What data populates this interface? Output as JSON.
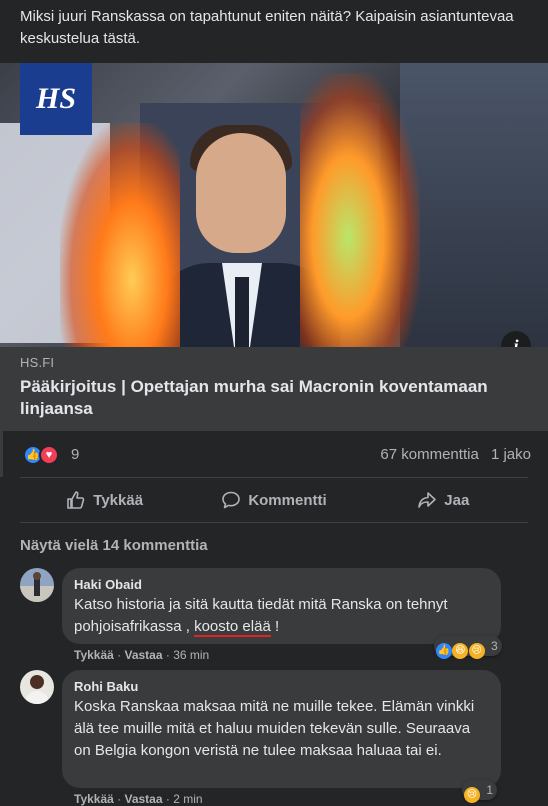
{
  "post": {
    "text": "Miksi juuri Ranskassa on tapahtunut eniten näitä? Kaipaisin asiantuntevaa keskustelua tästä."
  },
  "link": {
    "logo_text": "HS",
    "source": "HS.FI",
    "headline": "Pääkirjoitus | Opettajan murha sai Macronin koventamaan linjaansa",
    "info_icon": "i"
  },
  "stats": {
    "reaction_count": "9",
    "comments": "67 kommenttia",
    "shares": "1 jako"
  },
  "actions": {
    "like": "Tykkää",
    "comment": "Kommentti",
    "share": "Jaa"
  },
  "more_comments": "Näytä vielä 14 kommenttia",
  "comments": [
    {
      "author": "Haki Obaid",
      "text_before": "Katso historia ja sitä kautta tiedät mitä Ranska on tehnyt pohjoisafrikassa , ",
      "text_underlined": "koosto elää",
      "text_after": " !",
      "like": "Tykkää",
      "reply": "Vastaa",
      "time": "36 min",
      "reaction_count": "3"
    },
    {
      "author": "Rohi Baku",
      "text": "Koska Ranskaa maksaa mitä ne muille tekee. Elämän vinkki älä tee muille mitä et haluu muiden tekevän sulle. Seuraava on Belgia kongon veristä ne tulee maksaa haluaa tai ei.",
      "like": "Tykkää",
      "reply": "Vastaa",
      "time": "2 min",
      "reaction_count": "1"
    }
  ],
  "colors": {
    "background": "#242526",
    "card": "#3a3b3c",
    "text": "#e4e6eb",
    "muted": "#b0b3b8",
    "like_blue": "#2d88ff",
    "love_red": "#f33e58",
    "hs_blue": "#1b3d8f"
  }
}
